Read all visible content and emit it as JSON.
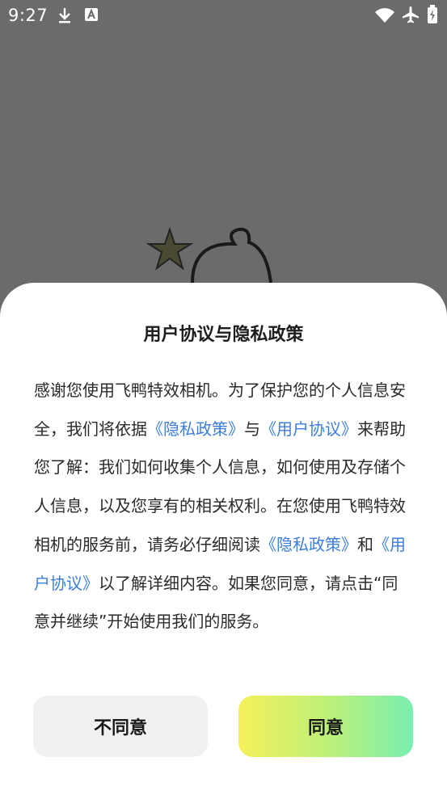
{
  "status_bar": {
    "time": "9:27",
    "icons": [
      "download-icon",
      "font-a-icon",
      "wifi-icon",
      "airplane-icon",
      "battery-icon"
    ]
  },
  "dialog": {
    "title": "用户协议与隐私政策",
    "body": {
      "text_1": "感谢您使用飞鸭特效相机。为了保护您的个人信息安全，我们将依据",
      "link_privacy_1": "《隐私政策》",
      "text_2": "与",
      "link_agreement_1": "《用户协议》",
      "text_3": "来帮助您了解：我们如何收集个人信息，如何使用及存储个人信息，以及您享有的相关权利。在您使用飞鸭特效相机的服务前，请务必仔细阅读",
      "link_privacy_2": "《隐私政策》",
      "text_4": "和",
      "link_agreement_2": "《用户协议》",
      "text_5": "以了解详细内容。如果您同意，请点击“同意并继续”开始使用我们的服务。"
    },
    "disagree_label": "不同意",
    "agree_label": "同意"
  },
  "colors": {
    "backdrop": "#6b6b6b",
    "link": "#3b7ee0",
    "agree_gradient_start": "#f5f05a",
    "agree_gradient_end": "#78efb0",
    "disagree_bg": "#f1f1f1"
  }
}
